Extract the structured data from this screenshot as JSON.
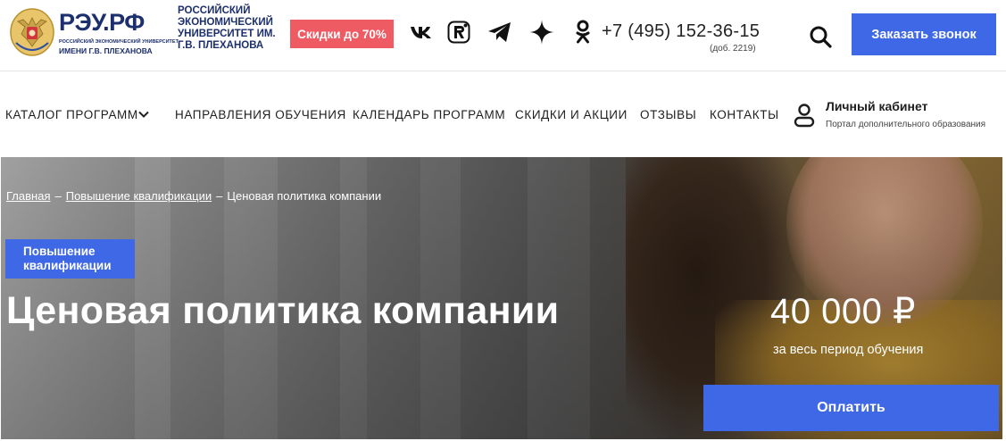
{
  "brand": {
    "logo_text": "РЭУ.РФ",
    "logo_sub1": "РОССИЙСКИЙ ЭКОНОМИЧЕСКИЙ УНИВЕРСИТЕТ",
    "logo_sub2": "ИМЕНИ Г.В. ПЛЕХАНОВА",
    "university_name": "РОССИЙСКИЙ ЭКОНОМИЧЕСКИЙ УНИВЕРСИТЕТ ИМ. Г.В. ПЛЕХАНОВА",
    "color": "#1c2f6e"
  },
  "header": {
    "promo_label": "Скидки до 70%",
    "promo_color": "#ef5b63",
    "social_icons": [
      "vk-icon",
      "rutube-icon",
      "telegram-icon",
      "dzen-icon",
      "odnoklassniki-icon"
    ],
    "phone": "+7 (495) 152-36-15",
    "phone_ext": "(доб. 2219)",
    "search_icon": "search-icon",
    "callback_label": "Заказать звонок",
    "accent_color": "#3f68e6"
  },
  "nav": {
    "items": [
      {
        "label": "КАТАЛОГ ПРОГРАММ"
      },
      {
        "label": "НАПРАВЛЕНИЯ ОБУЧЕНИЯ"
      },
      {
        "label": "КАЛЕНДАРЬ ПРОГРАММ"
      },
      {
        "label": "СКИДКИ И АКЦИИ"
      },
      {
        "label": "ОТЗЫВЫ"
      },
      {
        "label": "КОНТАКТЫ"
      }
    ],
    "cabinet_title": "Личный кабинет",
    "cabinet_sub": "Портал дополнительного образования"
  },
  "hero": {
    "breadcrumbs": [
      "Главная",
      "Повышение квалификации",
      "Ценовая политика компании"
    ],
    "badge": "Повышение квалификации",
    "title": "Ценовая политика компании",
    "price": "40 000 ₽",
    "price_note": "за весь период обучения",
    "pay_label": "Оплатить"
  }
}
